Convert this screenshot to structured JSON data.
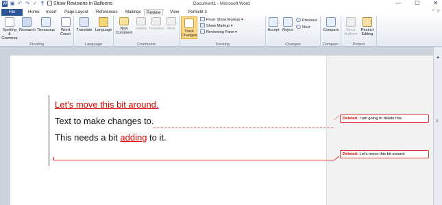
{
  "window": {
    "title": "Document1 - Microsoft Word",
    "quick_access_toolbar": [
      "word-app-icon",
      "save-icon",
      "undo-icon",
      "redo-icon",
      "spellcheck-icon",
      "paragraph-marks-icon",
      "show-revisions-in-balloons"
    ],
    "show_revisions_label": "Show Revisions in Balloons",
    "min_label": "—",
    "max_label": "☐",
    "close_label": "✕"
  },
  "tabs": [
    "File",
    "Home",
    "Insert",
    "Page Layout",
    "References",
    "Mailings",
    "Review",
    "View",
    "Perfectit 3"
  ],
  "active_tab": "Review",
  "ribbon": {
    "proofing": {
      "label": "Proofing",
      "buttons": [
        "Spelling & Grammar",
        "Research",
        "Thesaurus",
        "Word Count"
      ]
    },
    "language": {
      "label": "Language",
      "buttons": [
        "Translate",
        "Language"
      ]
    },
    "comments": {
      "label": "Comments",
      "buttons": [
        "New Comment",
        "Delete",
        "Previous",
        "Next"
      ]
    },
    "tracking": {
      "label": "Tracking",
      "track_changes": "Track Changes",
      "final_show_markup": "Final: Show Markup",
      "show_markup": "Show Markup",
      "reviewing_pane": "Reviewing Pane"
    },
    "changes": {
      "label": "Changes",
      "buttons": [
        "Accept",
        "Reject"
      ],
      "previous": "Previous",
      "next": "Next"
    },
    "compare": {
      "label": "Compare",
      "buttons": [
        "Compare"
      ]
    },
    "protect": {
      "label": "Protect",
      "buttons": [
        "Block Authors",
        "Restrict Editing"
      ]
    }
  },
  "document": {
    "line1_deleted": "Let’s move this bit around.",
    "line2": "Text to make changes to.",
    "line3_before": "This needs a bit ",
    "line3_inserted": "adding",
    "line3_after": " to it."
  },
  "balloons": [
    {
      "label": "Deleted:",
      "text": "I am going to delete this."
    },
    {
      "label": "Deleted:",
      "text": "Let’s move this bit around"
    }
  ],
  "colors": {
    "file_tab": "#2b579a",
    "revision": "#dd0000",
    "highlight": "#fcd88a"
  }
}
